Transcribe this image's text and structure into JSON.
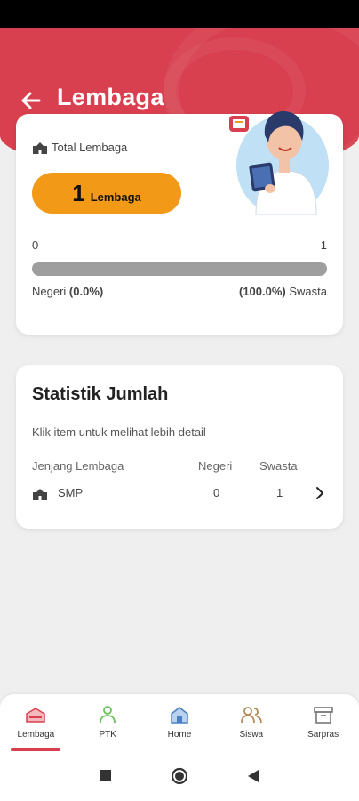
{
  "header": {
    "title": "Lembaga"
  },
  "summary": {
    "total_label": "Total Lembaga",
    "total_number": "1",
    "total_unit": "Lembaga",
    "range_min": "0",
    "range_max": "1",
    "negeri_label": "Negeri",
    "negeri_pct": "(0.0%)",
    "swasta_pct": "(100.0%)",
    "swasta_label": "Swasta",
    "swasta_fraction": 1.0
  },
  "stats": {
    "title": "Statistik Jumlah",
    "subtitle": "Klik item untuk melihat lebih detail",
    "columns": {
      "jenjang": "Jenjang Lembaga",
      "negeri": "Negeri",
      "swasta": "Swasta"
    },
    "rows": [
      {
        "name": "SMP",
        "negeri": "0",
        "swasta": "1"
      }
    ]
  },
  "nav": {
    "items": [
      {
        "label": "Lembaga",
        "icon": "school-icon",
        "active": true
      },
      {
        "label": "PTK",
        "icon": "teacher-icon",
        "active": false
      },
      {
        "label": "Home",
        "icon": "home-icon",
        "active": false
      },
      {
        "label": "Siswa",
        "icon": "students-icon",
        "active": false
      },
      {
        "label": "Sarpras",
        "icon": "archive-box-icon",
        "active": false
      }
    ]
  },
  "colors": {
    "primary": "#d8404f",
    "accent": "#f29a17",
    "track": "#9e9e9e"
  }
}
